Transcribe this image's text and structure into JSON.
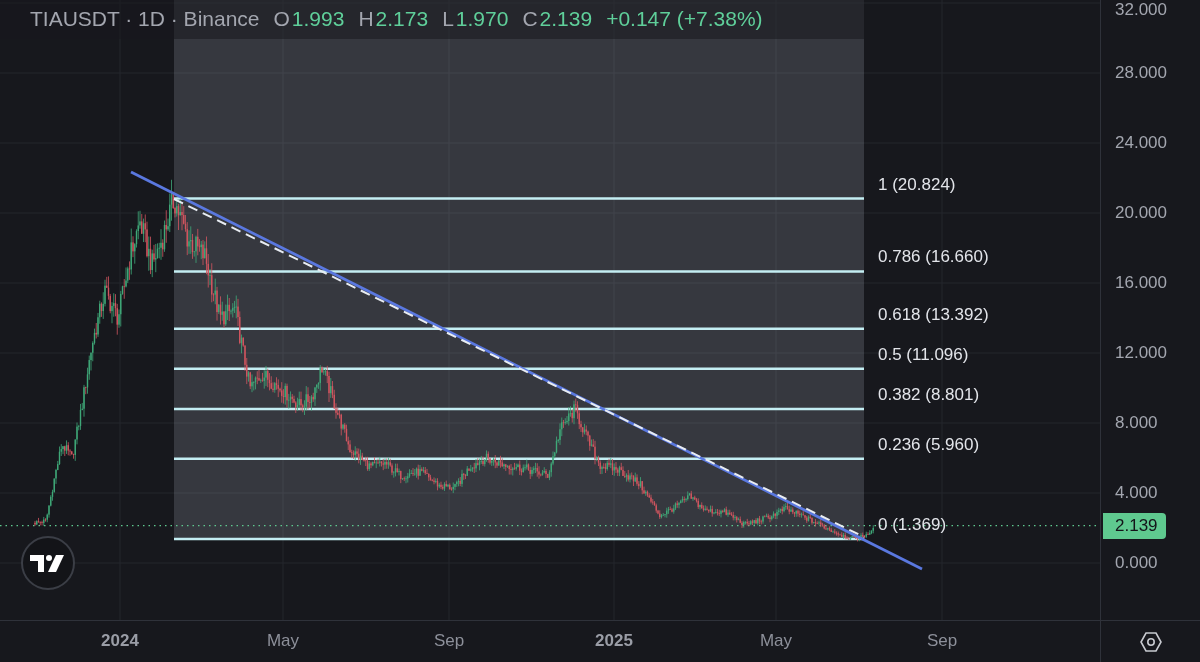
{
  "header": {
    "title": "TIAUSDT · 1D · Binance",
    "ohlc": [
      {
        "label": "O",
        "value": "1.993"
      },
      {
        "label": "H",
        "value": "2.173"
      },
      {
        "label": "L",
        "value": "1.970"
      },
      {
        "label": "C",
        "value": "2.139"
      }
    ],
    "change": "+0.147 (+7.38%)"
  },
  "fib_levels": [
    {
      "label": "1 (20.824)"
    },
    {
      "label": "0.786 (16.660)"
    },
    {
      "label": "0.618 (13.392)"
    },
    {
      "label": "0.5 (11.096)"
    },
    {
      "label": "0.382 (8.801)"
    },
    {
      "label": "0.236 (5.960)"
    },
    {
      "label": "0 (1.369)"
    }
  ],
  "price_axis": {
    "labels": [
      "32.000",
      "28.000",
      "24.000",
      "20.000",
      "16.000",
      "12.000",
      "8.000",
      "4.000",
      "0.000"
    ],
    "last_price": "2.139"
  },
  "time_axis": {
    "labels": [
      {
        "text": "2024",
        "kind": "year"
      },
      {
        "text": "May",
        "kind": "month"
      },
      {
        "text": "Sep",
        "kind": "month"
      },
      {
        "text": "2025",
        "kind": "year"
      },
      {
        "text": "May",
        "kind": "month"
      },
      {
        "text": "Sep",
        "kind": "month"
      }
    ]
  }
}
